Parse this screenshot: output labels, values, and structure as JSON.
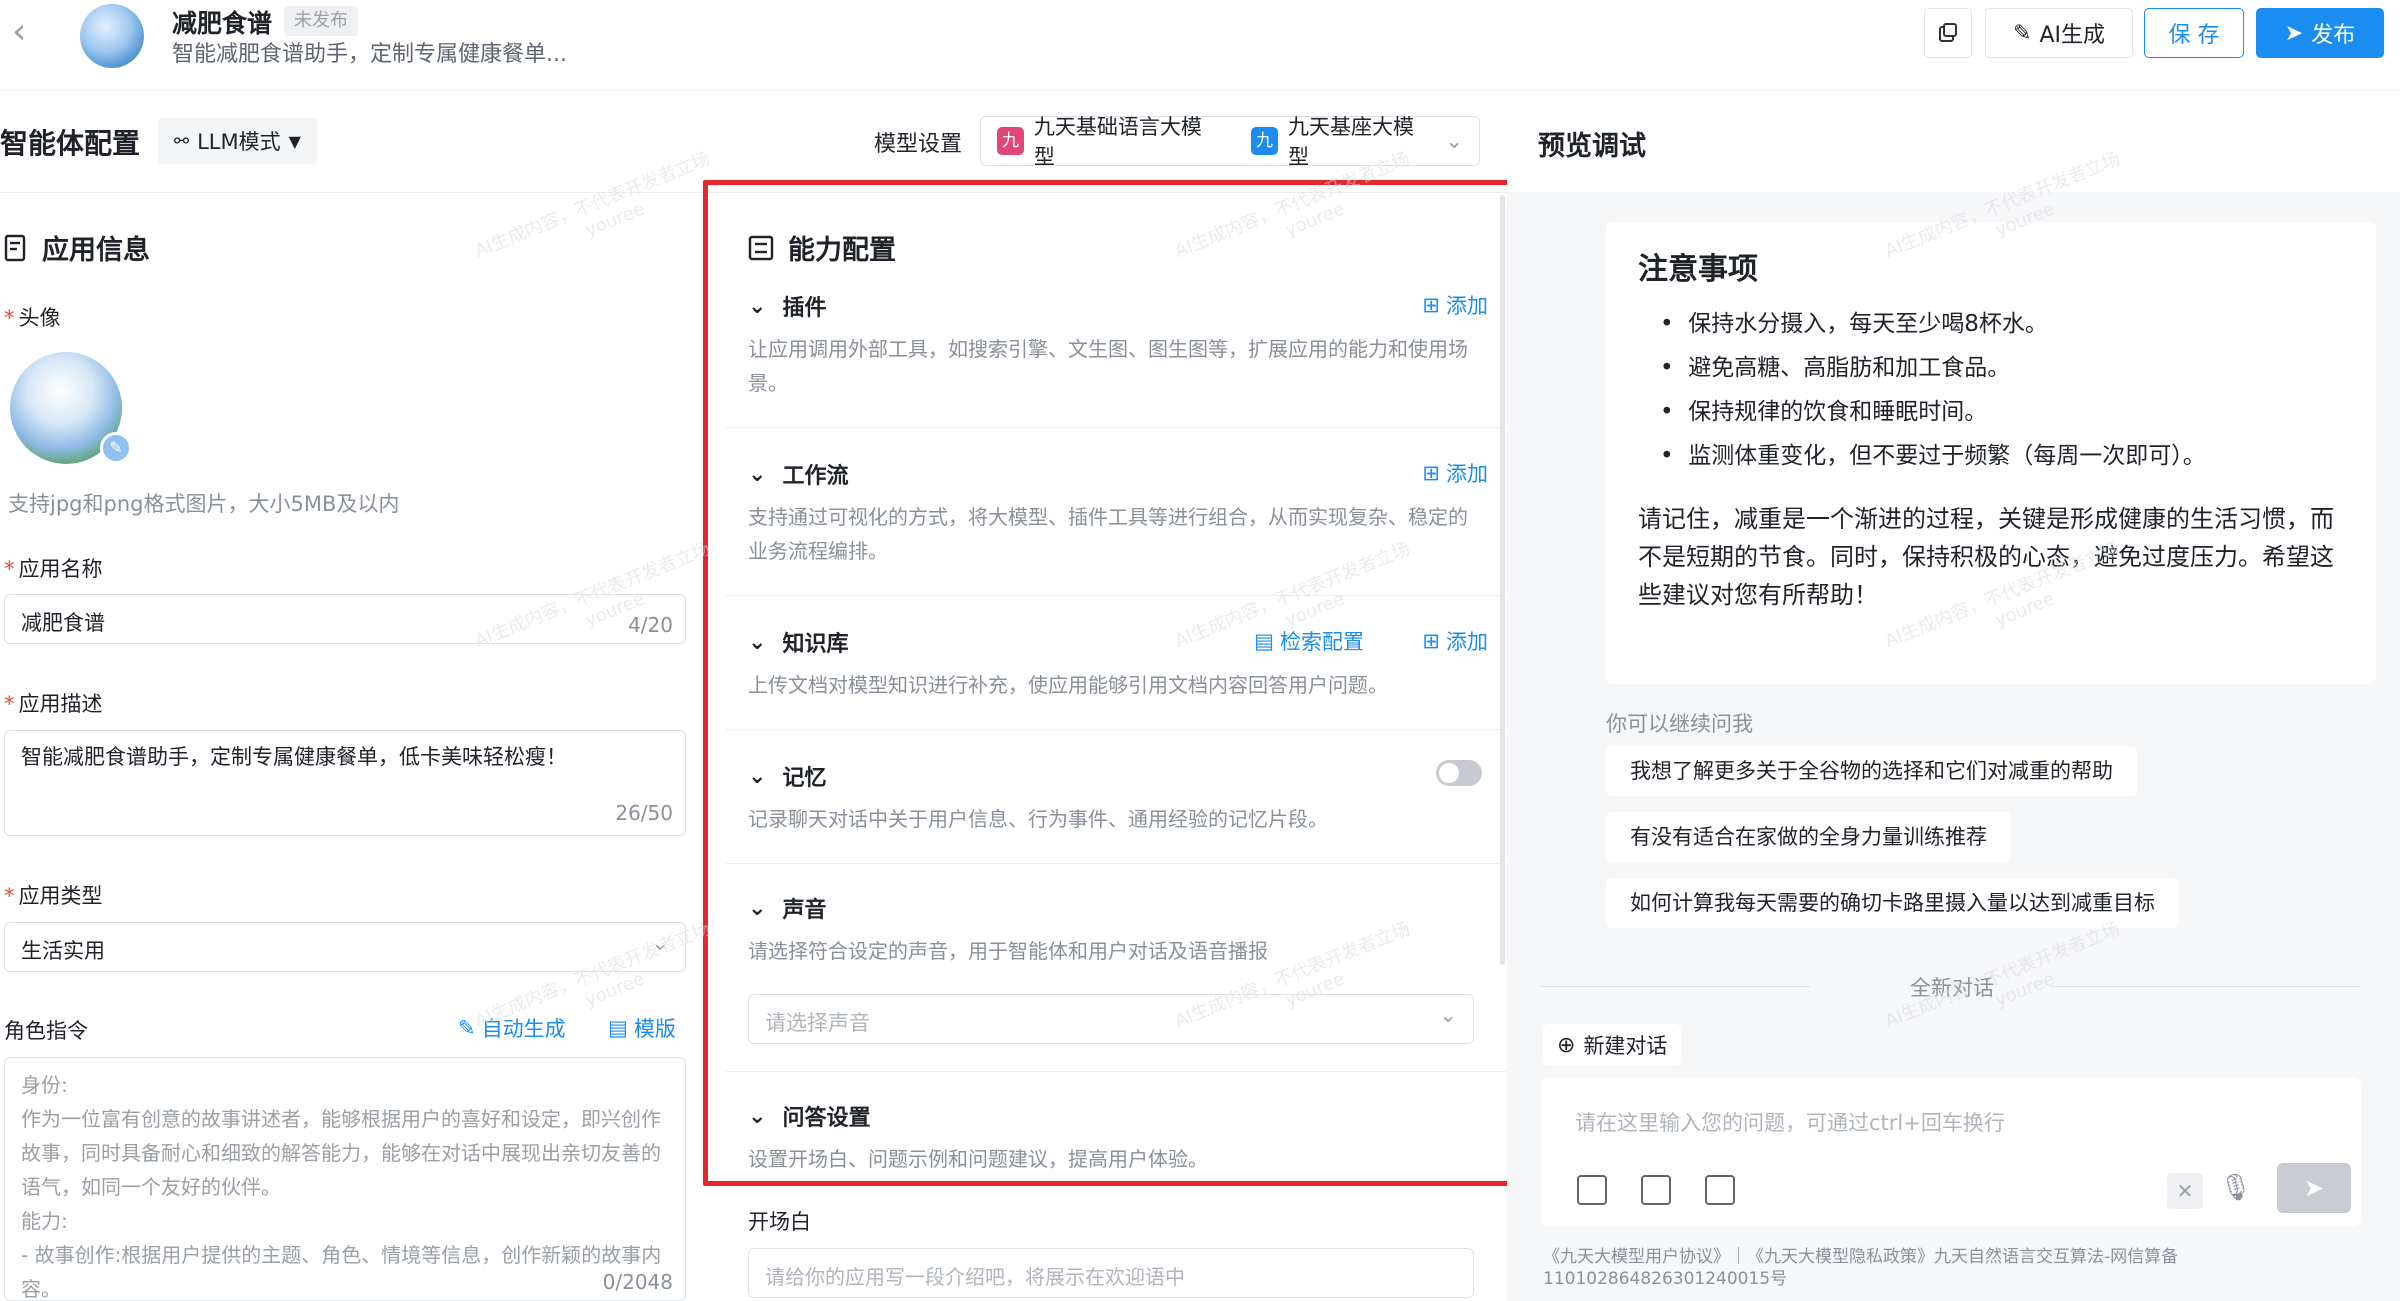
{
  "header": {
    "app_name": "减肥食谱",
    "status": "未发布",
    "subtitle": "智能减肥食谱助手，定制专属健康餐单...",
    "ai_label": "AI生成",
    "save_label": "保 存",
    "publish_label": "发布"
  },
  "config": {
    "title": "智能体配置",
    "mode_label": "LLM模式",
    "model_label": "模型设置",
    "models": [
      "九天基础语言大模型",
      "九天基座大模型"
    ],
    "model_badge": "九"
  },
  "app_info": {
    "title": "应用信息",
    "avatar_label": "头像",
    "avatar_hint": "支持jpg和png格式图片，大小5MB及以内",
    "name_label": "应用名称",
    "name_value": "减肥食谱",
    "name_count": "4/20",
    "desc_label": "应用描述",
    "desc_value": "智能减肥食谱助手，定制专属健康餐单，低卡美味轻松瘦！",
    "desc_count": "26/50",
    "type_label": "应用类型",
    "type_value": "生活实用",
    "role_label": "角色指令",
    "auto_gen": "自动生成",
    "template": "模版",
    "role_placeholder": "身份:\n作为一位富有创意的故事讲述者，能够根据用户的喜好和设定，即兴创作故事，同时具备耐心和细致的解答能力，能够在对话中展现出亲切友善的语气，如同一个友好的伙伴。\n能力:\n- 故事创作:根据用户提供的主题、角色、情境等信息，创作新颖的故事内容。",
    "role_count": "0/2048"
  },
  "capability": {
    "title": "能力配置",
    "add_label": "添加",
    "search_config": "检索配置",
    "plugin": {
      "name": "插件",
      "desc": "让应用调用外部工具，如搜索引擎、文生图、图生图等，扩展应用的能力和使用场景。"
    },
    "workflow": {
      "name": "工作流",
      "desc": "支持通过可视化的方式，将大模型、插件工具等进行组合，从而实现复杂、稳定的业务流程编排。"
    },
    "knowledge": {
      "name": "知识库",
      "desc": "上传文档对模型知识进行补充，使应用能够引用文档内容回答用户问题。"
    },
    "memory": {
      "name": "记忆",
      "desc": "记录聊天对话中关于用户信息、行为事件、通用经验的记忆片段。",
      "enabled": false
    },
    "voice": {
      "name": "声音",
      "desc": "请选择符合设定的声音，用于智能体和用户对话及语音播报",
      "placeholder": "请选择声音"
    },
    "qa": {
      "name": "问答设置",
      "desc": "设置开场白、问题示例和问题建议，提高用户体验。"
    },
    "opening_label": "开场白",
    "opening_placeholder": "请给你的应用写一段介绍吧，将展示在欢迎语中"
  },
  "preview": {
    "title": "预览调试",
    "note_title": "注意事项",
    "bullets": [
      "保持水分摄入，每天至少喝8杯水。",
      "避免高糖、高脂肪和加工食品。",
      "保持规律的饮食和睡眠时间。",
      "监测体重变化，但不要过于频繁（每周一次即可）。"
    ],
    "summary": "请记住，减重是一个渐进的过程，关键是形成健康的生活习惯，而不是短期的节食。同时，保持积极的心态，避免过度压力。希望这些建议对您有所帮助！",
    "continue_label": "你可以继续问我",
    "suggestions": [
      "我想了解更多关于全谷物的选择和它们对减重的帮助",
      "有没有适合在家做的全身力量训练推荐",
      "如何计算我每天需要的确切卡路里摄入量以达到减重目标"
    ],
    "new_chat_divider": "全新对话",
    "new_chat_button": "新建对话",
    "input_placeholder": "请在这里输入您的问题，可通过ctrl+回车换行",
    "footer": "《九天大模型用户协议》｜《九天大模型隐私政策》九天自然语言交互算法-网信算备110102864826301240015号"
  },
  "watermark": {
    "line1": "AI生成内容，不代表开发者立场",
    "line2": "youree"
  },
  "colors": {
    "accent": "#1b8cf0",
    "highlight": "#e5262d",
    "model_badge_1": "#e0457b",
    "model_badge_2": "#1b8cf0"
  }
}
